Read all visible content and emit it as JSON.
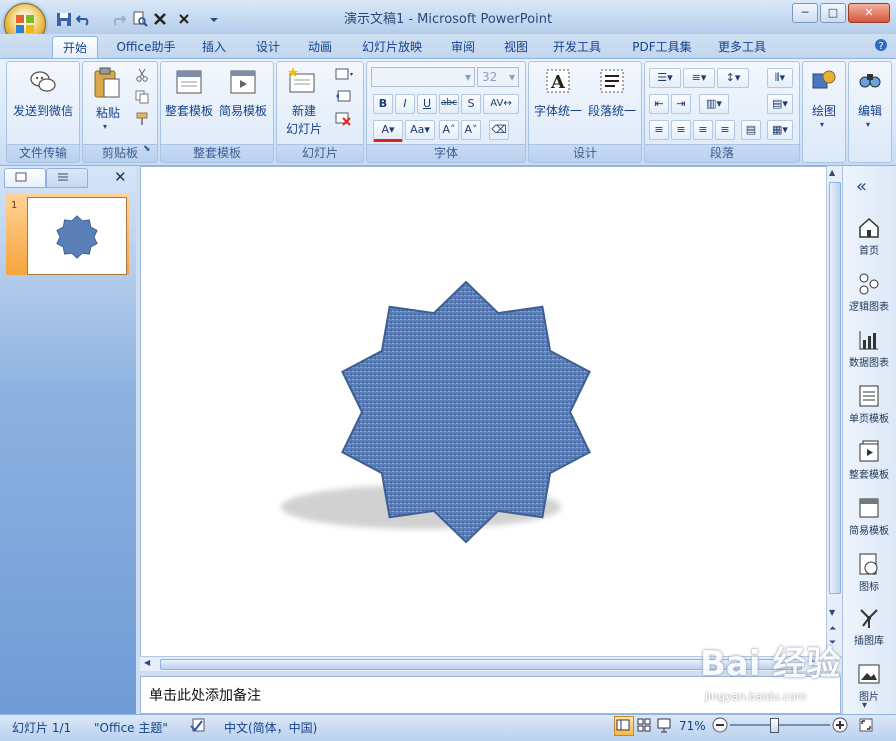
{
  "window": {
    "title": "演示文稿1 - Microsoft PowerPoint",
    "min_label": "─",
    "max_label": "□",
    "close_label": "✕"
  },
  "tabs": [
    {
      "label": "开始",
      "active": true
    },
    {
      "label": "Office助手"
    },
    {
      "label": "插入"
    },
    {
      "label": "设计"
    },
    {
      "label": "动画"
    },
    {
      "label": "幻灯片放映"
    },
    {
      "label": "审阅"
    },
    {
      "label": "视图"
    },
    {
      "label": "开发工具"
    },
    {
      "label": "PDF工具集"
    },
    {
      "label": "更多工具"
    }
  ],
  "ribbon": {
    "groups": {
      "file_transfer": {
        "label": "文件传输",
        "send_wechat": "发送到微信"
      },
      "clipboard": {
        "label": "剪贴板",
        "paste": "粘贴"
      },
      "templates": {
        "label": "整套模板",
        "full_template": "整套模板",
        "simple_template": "简易模板"
      },
      "slides": {
        "label": "幻灯片",
        "new_slide_1": "新建",
        "new_slide_2": "幻灯片"
      },
      "font": {
        "label": "字体",
        "font_size": "32"
      },
      "design": {
        "label": "设计",
        "font_unify": "字体统一",
        "para_unify": "段落统一"
      },
      "paragraph": {
        "label": "段落"
      },
      "drawing": {
        "label": "绘图"
      },
      "editing": {
        "label": "编辑"
      }
    }
  },
  "slide_panel": {
    "slide_number": "1"
  },
  "notes_placeholder": "单击此处添加备注",
  "task_panel": {
    "items": [
      "首页",
      "逻辑图表",
      "数据图表",
      "单页模板",
      "整套模板",
      "简易模板",
      "图标",
      "插图库",
      "图片"
    ]
  },
  "status": {
    "slide": "幻灯片 1/1",
    "theme": "\"Office 主题\"",
    "language": "中文(简体，中国)",
    "zoom": "71%"
  },
  "watermark": {
    "text": "Bai  经验",
    "url": "jingyan.baidu.com"
  },
  "colors": {
    "shape_fill": "#5b7fb8",
    "shape_stroke": "#3d5f95",
    "accent": "#15428b"
  }
}
